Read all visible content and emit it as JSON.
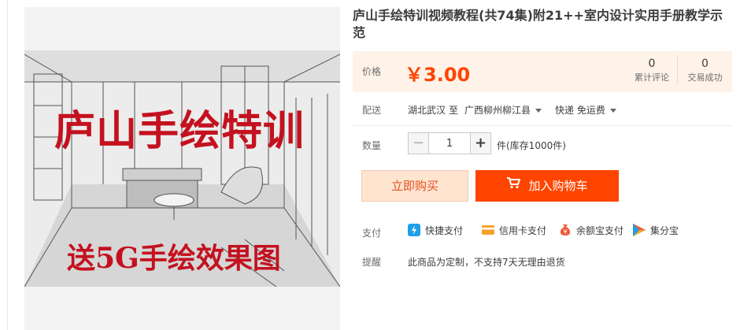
{
  "product": {
    "title": "庐山手绘特训视频教程(共74集)附21++室内设计实用手册教学示范",
    "banner_title": "庐山手绘特训",
    "banner_subtitle": "送5G手绘效果图"
  },
  "price": {
    "label": "价格",
    "value": "￥3.00",
    "reviews_count": "0",
    "reviews_label": "累计评论",
    "sales_count": "0",
    "sales_label": "交易成功"
  },
  "shipping": {
    "label": "配送",
    "from": "湖北武汉",
    "to_word": "至",
    "destination": "广西柳州柳江县",
    "method": "快递 免运费"
  },
  "quantity": {
    "label": "数量",
    "minus": "−",
    "value": "1",
    "plus": "+",
    "stock_text": "件(库存1000件)"
  },
  "actions": {
    "buy_now": "立即购买",
    "add_to_cart": "加入购物车"
  },
  "payment": {
    "label": "支付",
    "methods": [
      {
        "name": "快捷支付",
        "icon": "quick-pay-icon",
        "color": "#1e9fe8"
      },
      {
        "name": "信用卡支付",
        "icon": "credit-card-icon",
        "color": "#f6a02d"
      },
      {
        "name": "余额宝支付",
        "icon": "yuebao-icon",
        "color": "#f05a3a"
      },
      {
        "name": "集分宝",
        "icon": "jifenbao-icon",
        "color": "#2aa54a"
      }
    ]
  },
  "notice": {
    "label": "提醒",
    "text": "此商品为定制，不支持7天无理由退货"
  },
  "colors": {
    "accent": "#ff4400",
    "price": "#ff4400",
    "price_bg": "#fff2e8",
    "banner_red": "#c4111f"
  }
}
